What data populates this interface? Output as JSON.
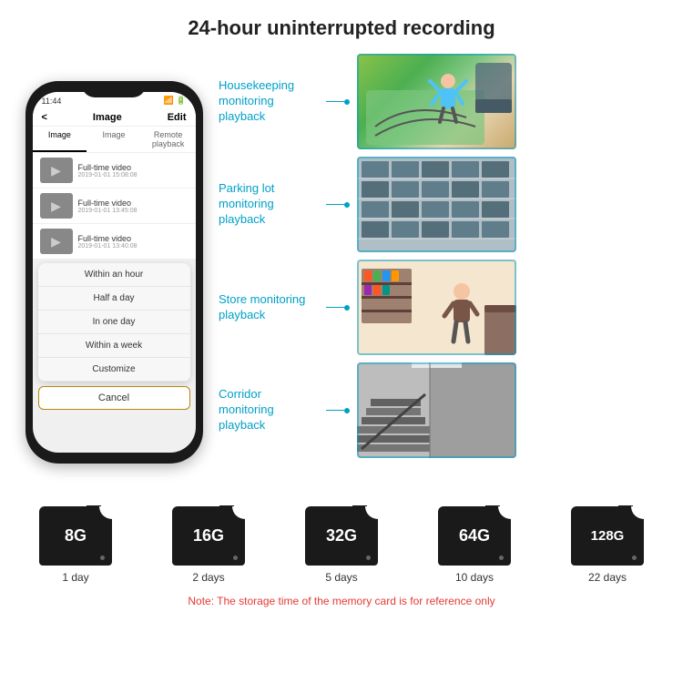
{
  "header": {
    "title": "24-hour uninterrupted recording"
  },
  "phone": {
    "status_time": "11:44",
    "title": "Image",
    "edit_btn": "Edit",
    "back_btn": "<",
    "tabs": [
      "Image",
      "Image",
      "Remote playback"
    ],
    "list_items": [
      {
        "title": "Full-time video",
        "subtitle": "2019-01-01 15:08:08"
      },
      {
        "title": "Full-time video",
        "subtitle": "2019-01-01 13:45:08"
      },
      {
        "title": "Full-time video",
        "subtitle": "2019-01-01 13:40:08"
      }
    ],
    "dropdown_items": [
      "Within an hour",
      "Half a day",
      "In one day",
      "Within a week",
      "Customize"
    ],
    "cancel_btn": "Cancel"
  },
  "monitoring": {
    "items": [
      {
        "label": "Housekeeping monitoring playback",
        "img_class": "img-housekeeping"
      },
      {
        "label": "Parking lot monitoring playback",
        "img_class": "img-parking"
      },
      {
        "label": "Store monitoring playback",
        "img_class": "img-store"
      },
      {
        "label": "Corridor monitoring playback",
        "img_class": "img-corridor"
      }
    ]
  },
  "storage": {
    "cards": [
      {
        "size": "8G",
        "days": "1 day"
      },
      {
        "size": "16G",
        "days": "2 days"
      },
      {
        "size": "32G",
        "days": "5 days"
      },
      {
        "size": "64G",
        "days": "10 days"
      },
      {
        "size": "128G",
        "days": "22 days"
      }
    ],
    "note": "Note: The storage time of the memory card is for reference only"
  }
}
